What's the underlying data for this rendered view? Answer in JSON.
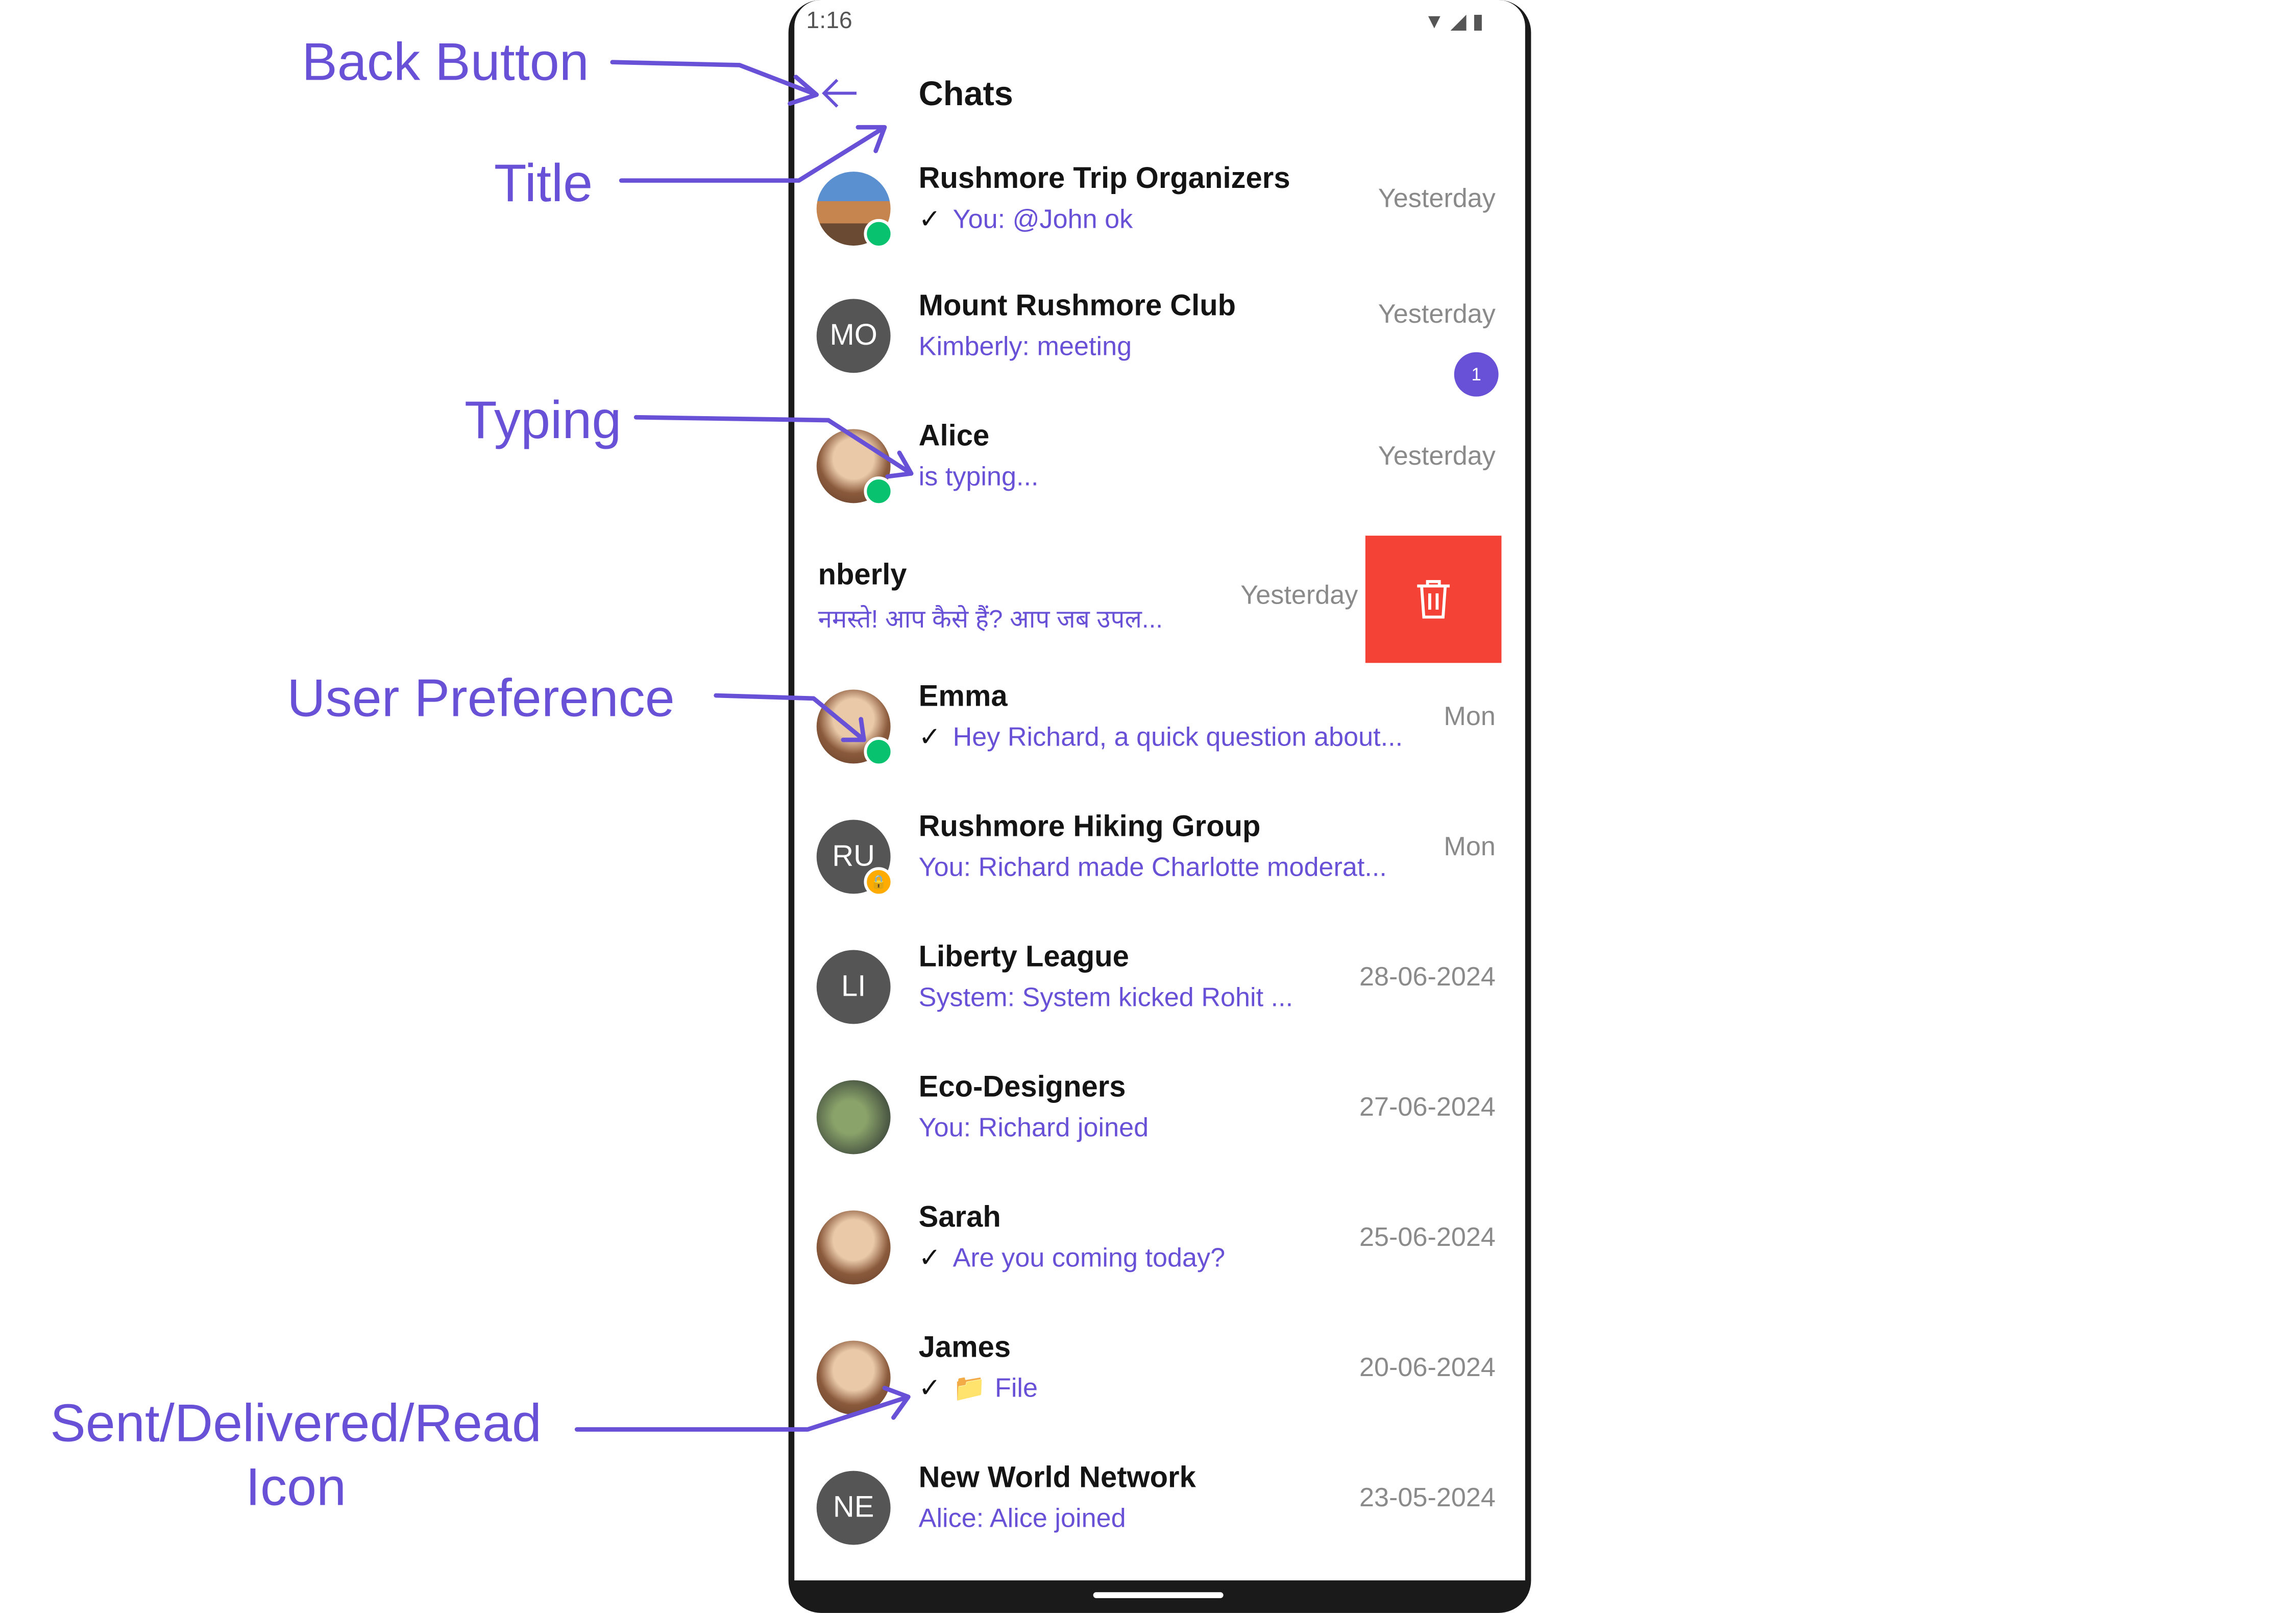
{
  "annotations": {
    "back": "Back Button",
    "title": "Title",
    "typing": "Typing",
    "preference": "User Preference",
    "receipts_line1": "Sent/Delivered/Read",
    "receipts_line2": "Icon"
  },
  "status_bar": {
    "time": "1:16"
  },
  "header": {
    "title": "Chats"
  },
  "chats": [
    {
      "name": "Rushmore Trip Organizers",
      "message": "You: @John ok",
      "date": "Yesterday"
    },
    {
      "initials": "MO",
      "name": "Mount Rushmore Club",
      "message": "Kimberly: meeting",
      "date": "Yesterday",
      "unread": "1"
    },
    {
      "name": "Alice",
      "message": "is typing...",
      "date": "Yesterday"
    },
    {
      "name": "nberly",
      "message": "नमस्ते! आप कैसे हैं?  आप जब उपल...",
      "date": "Yesterday"
    },
    {
      "name": "Emma",
      "message": "Hey Richard, a quick question about...",
      "date": "Mon"
    },
    {
      "initials": "RU",
      "name": "Rushmore Hiking Group",
      "message": "You: Richard made Charlotte moderat...",
      "date": "Mon"
    },
    {
      "initials": "LI",
      "name": "Liberty League",
      "message": "System: System kicked Rohit ...",
      "date": "28-06-2024"
    },
    {
      "name": "Eco-Designers",
      "message": "You: Richard joined",
      "date": "27-06-2024"
    },
    {
      "name": "Sarah",
      "message": "Are you coming today?",
      "date": "25-06-2024"
    },
    {
      "name": "James",
      "message": "File",
      "date": "20-06-2024"
    },
    {
      "initials": "NE",
      "name": "New World Network",
      "message": "Alice: Alice joined",
      "date": "23-05-2024"
    }
  ],
  "colors": {
    "accent": "#6851D6",
    "online": "#09C26F",
    "delete": "#F44336",
    "private": "#FFAB00"
  },
  "icons": {
    "back": "arrow-left-icon",
    "delete": "trash-icon",
    "read_receipt": "checkmark-icon",
    "file": "folder-icon"
  }
}
